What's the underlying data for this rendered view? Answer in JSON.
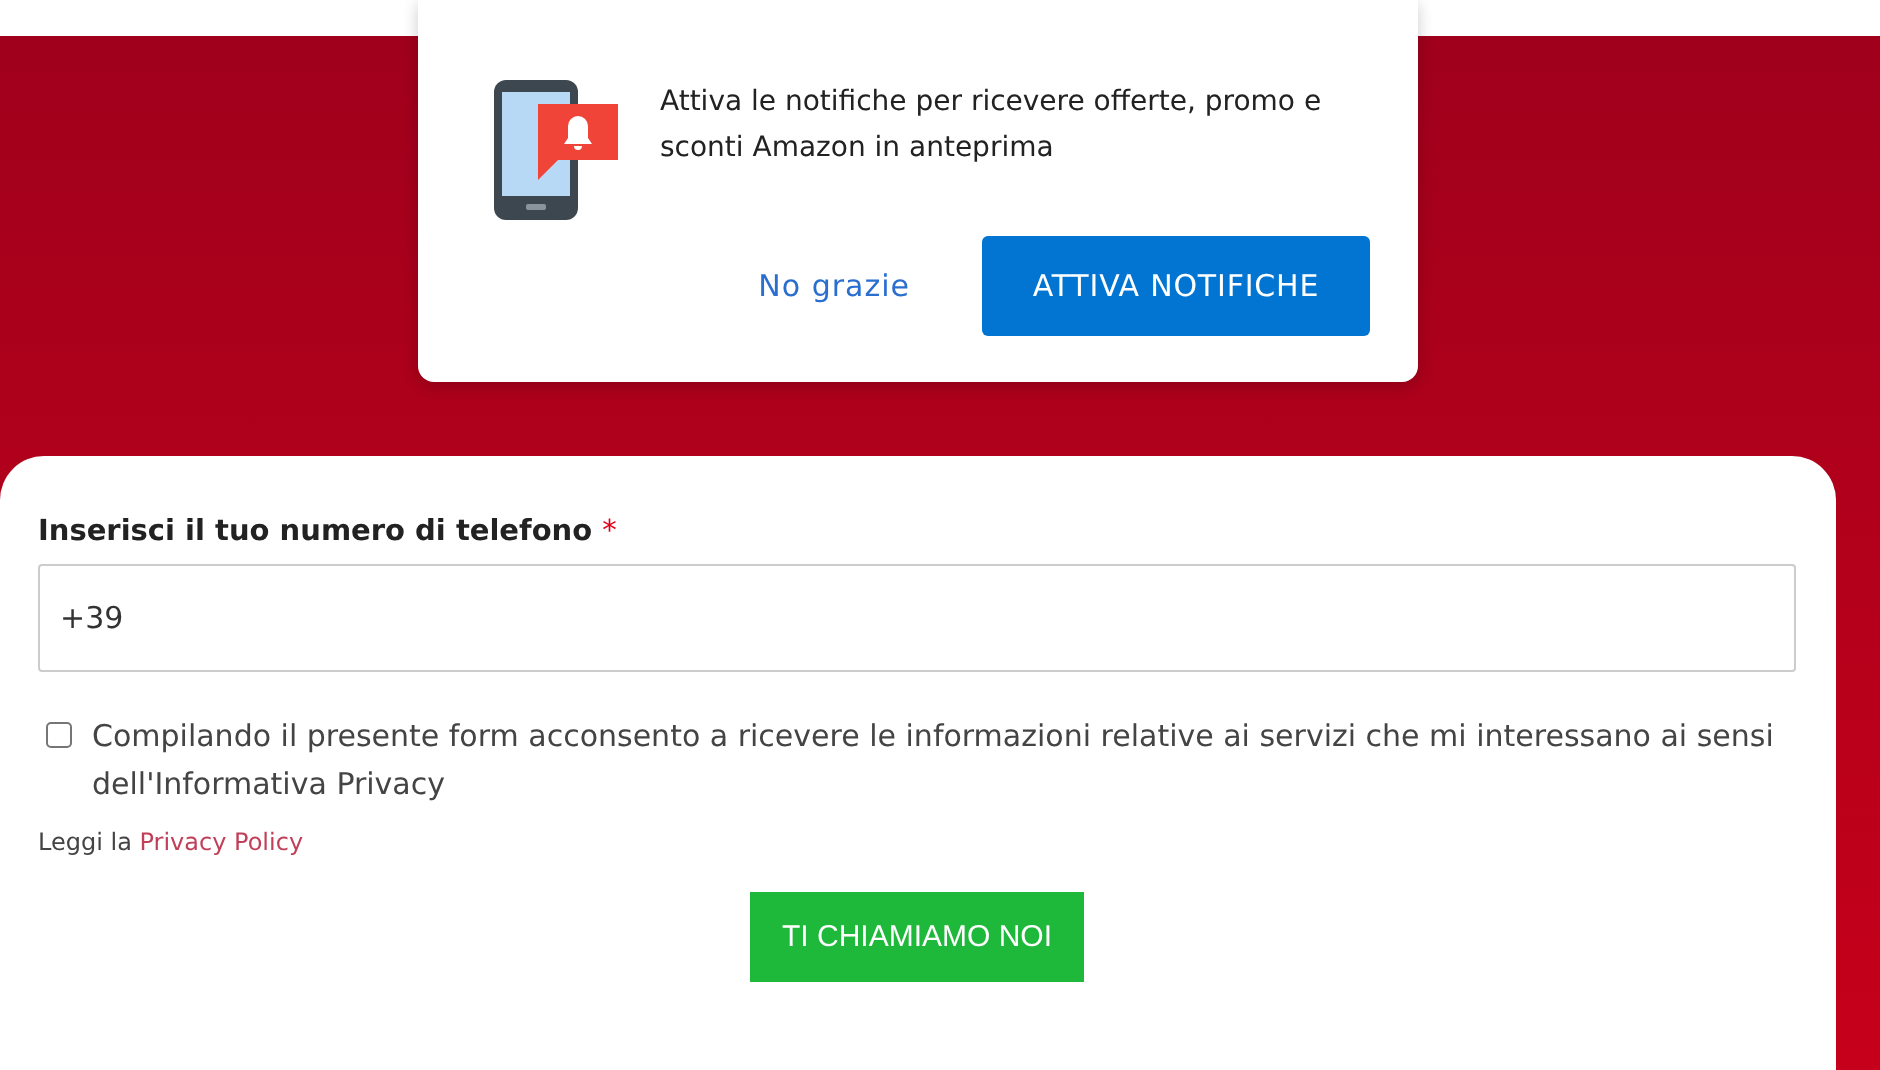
{
  "notification_popup": {
    "message": "Attiva le notifiche per ricevere offerte, promo e sconti Amazon in anteprima",
    "dismiss_button": "No grazie",
    "accept_button": "ATTIVA NOTIFICHE"
  },
  "form": {
    "phone_label": "Inserisci il tuo numero di telefono",
    "required_mark": "*",
    "phone_value": "+39",
    "consent": {
      "checked": false,
      "text": "Compilando il presente form acconsento a ricevere le informazioni relative ai servizi che mi interessano ai sensi dell'Informativa Privacy"
    },
    "privacy_prefix": "Leggi la",
    "privacy_link": "Privacy Policy",
    "submit_button": "TI CHIAMIAMO NOI"
  }
}
